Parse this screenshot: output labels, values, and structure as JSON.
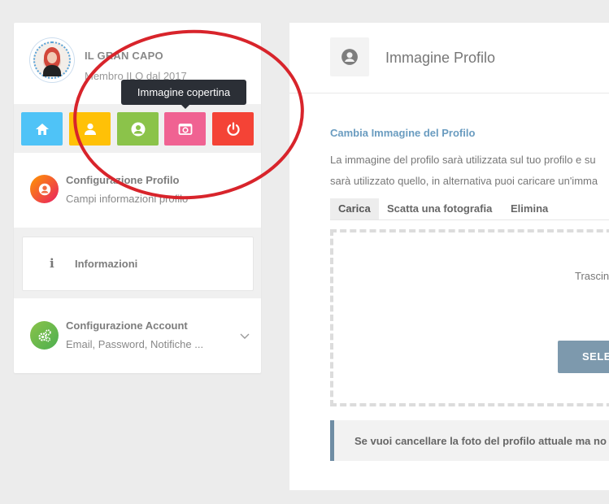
{
  "sidebar": {
    "user": {
      "name": "IL GRAN CAPO",
      "meta": "Membro ILO dal 2017"
    },
    "tooltip": "Immagine copertina",
    "actions": [
      {
        "name": "home-button",
        "icon": "home-icon",
        "color": "#4fc3f7"
      },
      {
        "name": "profile-button",
        "icon": "user-icon",
        "color": "#ffc107"
      },
      {
        "name": "avatar-button",
        "icon": "user-circle-icon",
        "color": "#8bc34a"
      },
      {
        "name": "cover-image-button",
        "icon": "camera-icon",
        "color": "#f06292"
      },
      {
        "name": "logout-button",
        "icon": "power-icon",
        "color": "#f44336"
      }
    ],
    "menu": [
      {
        "title": "Configurazione Profilo",
        "sub": "Campi informazioni profilo"
      },
      {
        "title": "Informazioni"
      },
      {
        "title": "Configurazione Account",
        "sub": "Email, Password, Notifiche ..."
      }
    ]
  },
  "main": {
    "title": "Immagine Profilo",
    "section_title": "Cambia Immagine del Profilo",
    "desc_line1": "La immagine del profilo sarà utilizzata sul tuo profilo e su",
    "desc_line2": "sarà utilizzato quello, in alternativa puoi caricare un'imma",
    "tabs": [
      "Carica",
      "Scatta una fotografia",
      "Elimina"
    ],
    "drop_text": "Trascin",
    "select_button": "SELEZ",
    "notice": "Se vuoi cancellare la foto del profilo attuale ma no"
  }
}
